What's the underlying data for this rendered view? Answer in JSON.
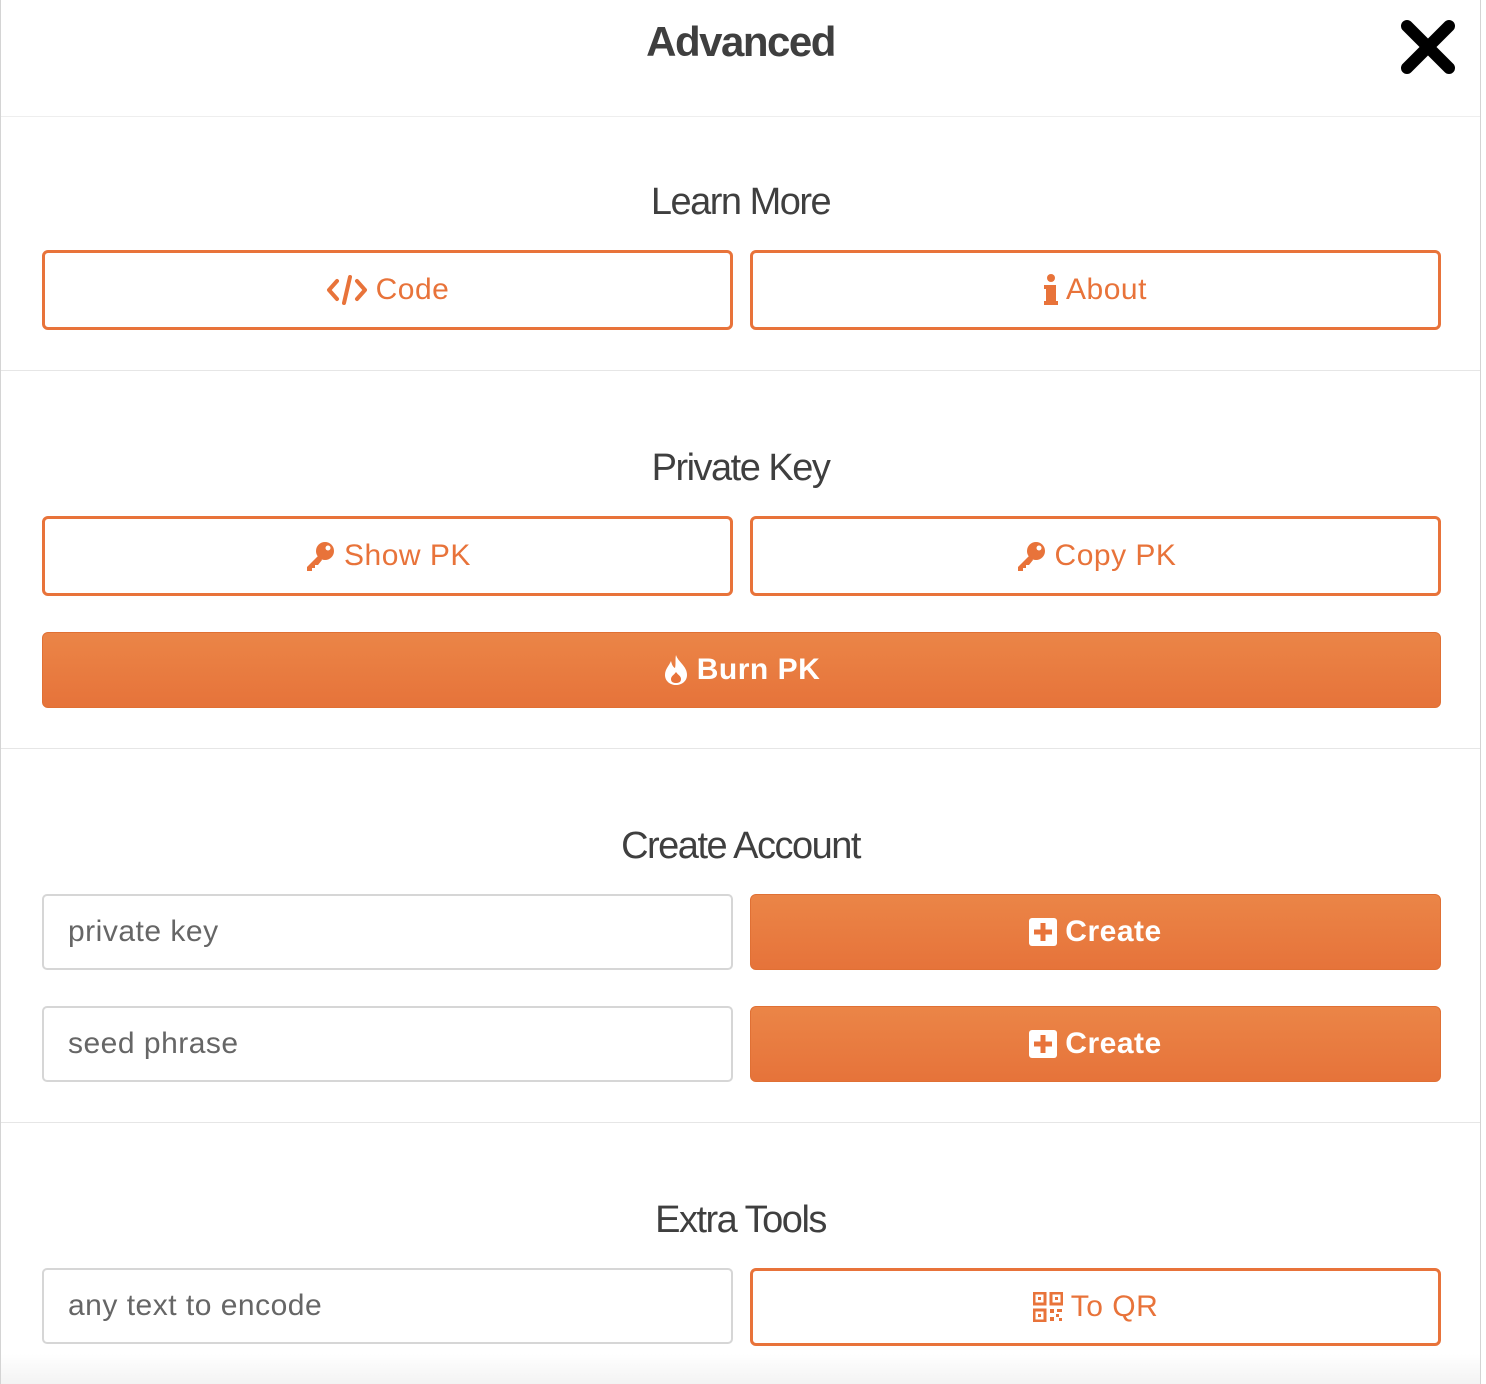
{
  "modal": {
    "title": "Advanced",
    "close_icon": "close-icon",
    "accent_color": "#e8733a"
  },
  "learn_more": {
    "title": "Learn More",
    "code_label": "Code",
    "about_label": "About"
  },
  "private_key": {
    "title": "Private Key",
    "show_label": "Show PK",
    "copy_label": "Copy PK",
    "burn_label": "Burn PK"
  },
  "create_account": {
    "title": "Create Account",
    "pk_placeholder": "private key",
    "seed_placeholder": "seed phrase",
    "create_label": "Create"
  },
  "extra_tools": {
    "title": "Extra Tools",
    "encode_placeholder": "any text to encode",
    "qr_label": "To QR"
  }
}
